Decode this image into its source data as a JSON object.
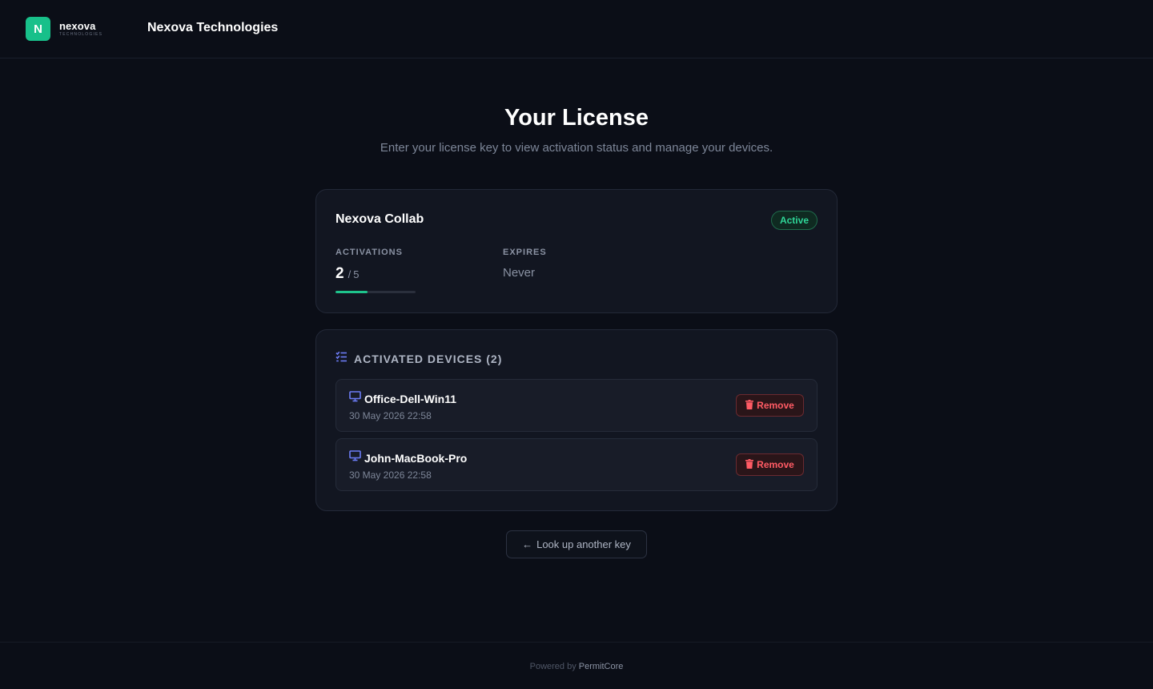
{
  "header": {
    "logo_initial": "N",
    "logo_word": "nexova",
    "logo_sub": "TECHNOLOGIES",
    "company_name": "Nexova Technologies"
  },
  "page": {
    "title": "Your License",
    "subtitle": "Enter your license key to view activation status and manage your devices."
  },
  "license": {
    "product_name": "Nexova Collab",
    "status": "Active",
    "activations_label": "ACTIVATIONS",
    "activations_used": "2",
    "activations_sep": "/",
    "activations_total": "5",
    "activations_fraction": 0.4,
    "expires_label": "EXPIRES",
    "expires_value": "Never"
  },
  "devices": {
    "title": "ACTIVATED DEVICES (2)",
    "items": [
      {
        "name": "Office-Dell-Win11",
        "date": "30 May 2026 22:58",
        "remove_label": "Remove"
      },
      {
        "name": "John-MacBook-Pro",
        "date": "30 May 2026 22:58",
        "remove_label": "Remove"
      }
    ]
  },
  "back_button": {
    "label": "Look up another key"
  },
  "footer": {
    "prefix": "Powered by",
    "brand": "PermitCore"
  },
  "colors": {
    "accent": "#18c08a",
    "danger": "#ff5b64",
    "icon_accent": "#6c7cf6"
  },
  "icons": {
    "list": "list-check-icon",
    "device": "monitor-icon",
    "remove": "trash-icon",
    "back": "arrow-left-icon"
  }
}
